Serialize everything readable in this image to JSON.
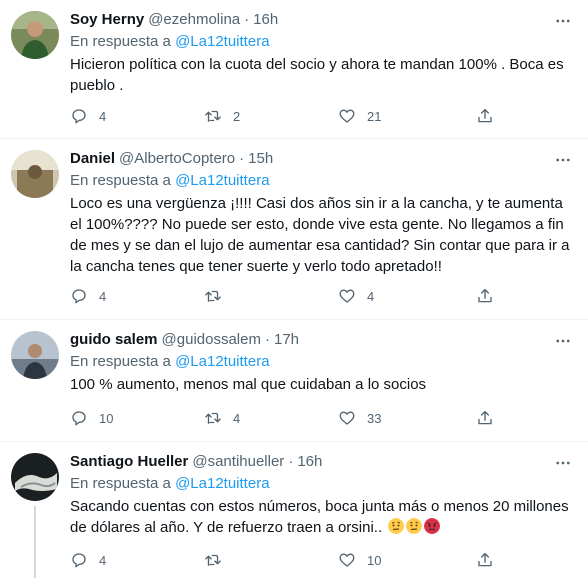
{
  "tweets": [
    {
      "name": "Soy Herny",
      "handle": "@ezehmolina",
      "separator": "·",
      "time": "16h",
      "reply_prefix": "En respuesta a",
      "reply_to": "@La12tuittera",
      "text": "Hicieron política con la cuota del socio y ahora te mandan 100% . Boca es pueblo .",
      "replies": "4",
      "retweets": "2",
      "likes": "21"
    },
    {
      "name": "Daniel",
      "handle": "@AlbertoCoptero",
      "separator": "·",
      "time": "15h",
      "reply_prefix": "En respuesta a",
      "reply_to": "@La12tuittera",
      "text": "Loco es una vergüenza ¡!!!! Casi dos años sin ir a la cancha, y te aumenta el 100%???? No puede ser esto, donde vive esta gente. No llegamos a fin de mes y se dan el lujo de aumentar esa cantidad? Sin contar que para ir a la cancha tenes que tener suerte y verlo todo apretado!!",
      "replies": "4",
      "retweets": "",
      "likes": "4"
    },
    {
      "name": "guido salem",
      "handle": "@guidossalem",
      "separator": "·",
      "time": "17h",
      "reply_prefix": "En respuesta a",
      "reply_to": "@La12tuittera",
      "text": "100 % aumento, menos mal que cuidaban a lo socios",
      "replies": "10",
      "retweets": "4",
      "likes": "33"
    },
    {
      "name": "Santiago Hueller",
      "handle": "@santihueller",
      "separator": "·",
      "time": "16h",
      "reply_prefix": "En respuesta a",
      "reply_to": "@La12tuittera",
      "text": "Sacando cuentas con estos números, boca junta más o menos 20 millones de dólares al año. Y de refuerzo traen a orsini..",
      "replies": "4",
      "retweets": "",
      "likes": "10"
    }
  ],
  "icons": {
    "reply": "reply-icon",
    "retweet": "retweet-icon",
    "like": "heart-icon",
    "share": "share-icon",
    "more": "more-icon"
  },
  "colors": {
    "link": "#1d9bf0",
    "muted": "#536471",
    "text": "#0f1419",
    "divider": "#eff3f4"
  }
}
